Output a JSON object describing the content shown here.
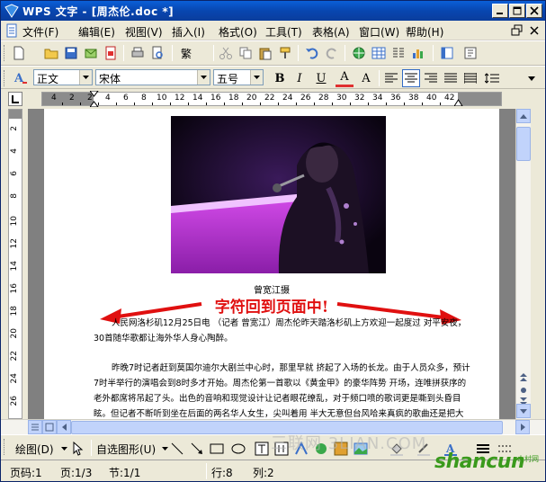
{
  "window": {
    "title": "WPS 文字 - [周杰伦.doc *]",
    "colors": {
      "titlebar": "#0846b0",
      "annotation": "#e01010",
      "scroll": "#c1d3fb"
    }
  },
  "menu": {
    "items": [
      "文件(F)",
      "编辑(E)",
      "视图(V)",
      "插入(I)",
      "格式(O)",
      "工具(T)",
      "表格(A)",
      "窗口(W)",
      "帮助(H)"
    ]
  },
  "format_toolbar": {
    "style": "正文",
    "font": "宋体",
    "size": "五号",
    "traditional_label": "繁",
    "bold": "B",
    "italic": "I",
    "underline": "U",
    "font_color": "A",
    "char_scale": "A"
  },
  "ruler": {
    "h_numbers": [
      "4",
      "2",
      "2",
      "4",
      "6",
      "8",
      "10",
      "12",
      "14",
      "16",
      "18",
      "20",
      "22",
      "24",
      "26",
      "28",
      "30",
      "32",
      "34",
      "36",
      "38",
      "40",
      "42"
    ],
    "v_numbers": [
      "2",
      "4",
      "6",
      "8",
      "10",
      "12",
      "14",
      "16",
      "18",
      "20",
      "22",
      "24",
      "26"
    ]
  },
  "document": {
    "photo_caption": "曾宽江摄",
    "annotation": "字符回到页面中!",
    "paragraphs": [
      "人民网洛杉矶12月25日电 （记者 曾宽江）周杰伦昨天踏洛杉矶上方欢迎一起度过 对平安夜，30首随华歌都让海外华人身心陶醉。",
      "昨晚7时记者赶到莫国尔迪尔大剧兰中心时，那里早就 挤起了入场的长龙。由于人员众多，预计7时半举行的演唱会到8时多才开始。周杰伦第一首歌以《黄金甲》的豪华阵势 开场，连唯拼获序的老外都席将吊起了头。出色的音响和现觉设计让记者眼花缭乱，对于频口喷的歌词更是嘶到头昏目眩。但记者不断听到坐在后面的两名华人女生，尖叫着用 半大无意但台风哈来真疯的歌曲还是把大家逗乐了。"
    ]
  },
  "draw_toolbar": {
    "draw_label": "绘图(D)",
    "autoshape_label": "自选图形(U)"
  },
  "status": {
    "page_code": "页码:1",
    "page": "页:1/3",
    "section": "节:1/1",
    "line": "行:8",
    "column": "列:2"
  },
  "watermark": {
    "site": "三联网 3LIAN.COM",
    "logo": "shancun",
    "logo_sub": "山村网"
  }
}
